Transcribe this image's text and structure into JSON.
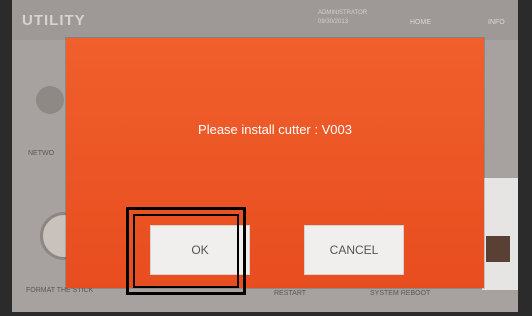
{
  "app": {
    "title": "UTILITY"
  },
  "status": {
    "line1": "ADMINISTRATOR",
    "line2": "09/30/2013"
  },
  "nav": {
    "home": "HOME",
    "info": "INFO"
  },
  "background": {
    "network_label": "NETWO",
    "format_label": "FORMAT THE STICK",
    "restart_label": "RESTART",
    "system_label": "SYSTEM REBOOT"
  },
  "dialog": {
    "message": "Please install cutter : V003",
    "ok_label": "OK",
    "cancel_label": "CANCEL"
  },
  "colors": {
    "dialog": "#e84d1f",
    "button": "#f1efed",
    "highlight": "#000000"
  }
}
